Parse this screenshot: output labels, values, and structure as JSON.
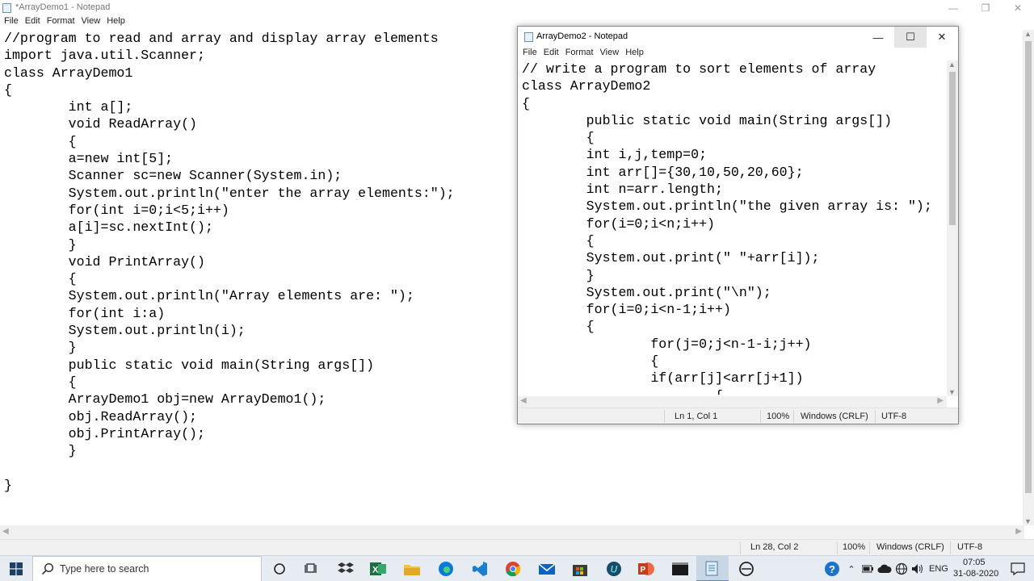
{
  "window1": {
    "title": "*ArrayDemo1 - Notepad",
    "menu": [
      "File",
      "Edit",
      "Format",
      "View",
      "Help"
    ],
    "code": "//program to read and array and display array elements\nimport java.util.Scanner;\nclass ArrayDemo1\n{\n        int a[];\n        void ReadArray()\n        {\n        a=new int[5];\n        Scanner sc=new Scanner(System.in);\n        System.out.println(\"enter the array elements:\");\n        for(int i=0;i<5;i++)\n        a[i]=sc.nextInt();\n        }\n        void PrintArray()\n        {\n        System.out.println(\"Array elements are: \");\n        for(int i:a)\n        System.out.println(i);\n        }\n        public static void main(String args[])\n        {\n        ArrayDemo1 obj=new ArrayDemo1();\n        obj.ReadArray();\n        obj.PrintArray();\n        }\n\n}",
    "status": {
      "position": "Ln 28, Col 2",
      "zoom": "100%",
      "line_ending": "Windows (CRLF)",
      "encoding": "UTF-8"
    }
  },
  "window2": {
    "title": "ArrayDemo2 - Notepad",
    "menu": [
      "File",
      "Edit",
      "Format",
      "View",
      "Help"
    ],
    "code": "// write a program to sort elements of array\nclass ArrayDemo2\n{\n        public static void main(String args[])\n        {\n        int i,j,temp=0;\n        int arr[]={30,10,50,20,60};\n        int n=arr.length;\n        System.out.println(\"the given array is: \");\n        for(i=0;i<n;i++)\n        {\n        System.out.print(\" \"+arr[i]);\n        }\n        System.out.print(\"\\n\");\n        for(i=0;i<n-1;i++)\n        {\n                for(j=0;j<n-1-i;j++)\n                {\n                if(arr[j]<arr[j+1])\n                        {",
    "status": {
      "position": "Ln 1, Col 1",
      "zoom": "100%",
      "line_ending": "Windows (CRLF)",
      "encoding": "UTF-8"
    }
  },
  "taskbar": {
    "search_placeholder": "Type here to search",
    "language": "ENG",
    "time": "07:05",
    "date": "31-08-2020"
  },
  "colors": {
    "taskbar_bg": "#e6ecf2",
    "excel": "#1d6f42",
    "edge": "#0c7bd6",
    "chrome_red": "#db4437",
    "powerpoint": "#c43e1c",
    "help_blue": "#1e73c8"
  }
}
